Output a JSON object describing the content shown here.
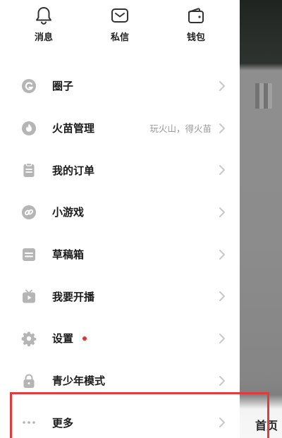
{
  "top_actions": [
    {
      "label": "消息",
      "icon": "bell-icon"
    },
    {
      "label": "私信",
      "icon": "envelope-icon"
    },
    {
      "label": "钱包",
      "icon": "wallet-icon"
    }
  ],
  "menu": [
    {
      "label": "圈子",
      "icon": "circle-g-icon",
      "hint": ""
    },
    {
      "label": "火苗管理",
      "icon": "flame-icon",
      "hint": "玩火山，得火苗"
    },
    {
      "label": "我的订单",
      "icon": "clipboard-icon",
      "hint": ""
    },
    {
      "label": "小游戏",
      "icon": "game-link-icon",
      "hint": ""
    },
    {
      "label": "草稿箱",
      "icon": "drafts-box-icon",
      "hint": ""
    },
    {
      "label": "我要开播",
      "icon": "live-tv-icon",
      "hint": ""
    },
    {
      "label": "设置",
      "icon": "gear-icon",
      "hint": "",
      "badge_dot": true
    },
    {
      "label": "青少年模式",
      "icon": "lock-icon",
      "hint": ""
    },
    {
      "label": "更多",
      "icon": "more-dots-icon",
      "hint": ""
    }
  ],
  "background": {
    "home_tab_label": "首页"
  },
  "colors": {
    "badge_red": "#e5322d",
    "highlight_red": "#e23b3b",
    "icon_gray": "#b5b5b5",
    "chevron_gray": "#c8c8c8"
  }
}
